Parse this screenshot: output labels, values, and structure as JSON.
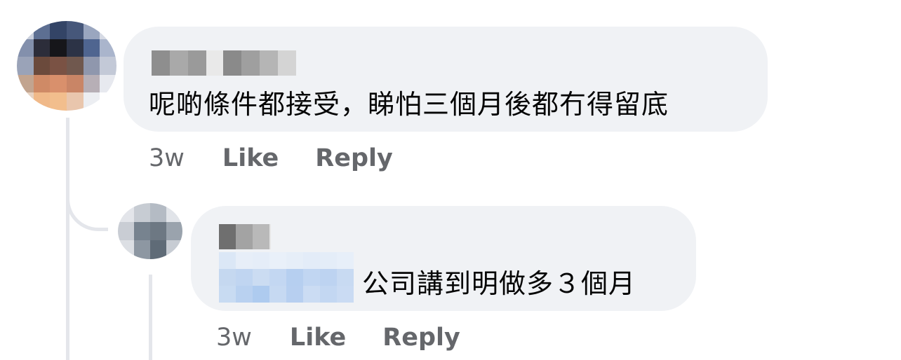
{
  "comments": [
    {
      "text": "呢啲條件都接受，睇怕三個月後都冇得留底",
      "time": "3w",
      "like_label": "Like",
      "reply_label": "Reply"
    },
    {
      "text": "公司講到明做多３個月",
      "time": "3w",
      "like_label": "Like",
      "reply_label": "Reply"
    }
  ],
  "colors": {
    "bubble_bg": "#f0f2f5",
    "thread_line": "#e4e6eb",
    "meta_text": "#65676b",
    "body_text": "#050505",
    "mention_blue": "#c9dcf3"
  },
  "icons": {
    "main_avatar": "pixelated-profile-photo",
    "reply_avatar": "pixelated-profile-photo"
  }
}
